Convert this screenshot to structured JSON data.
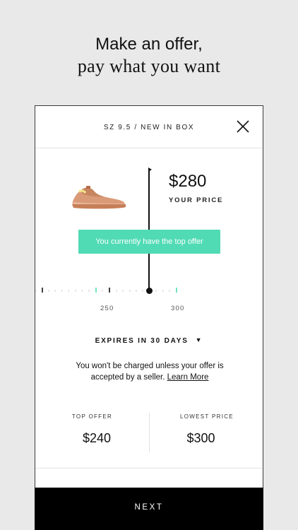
{
  "headline": {
    "line1": "Make an offer,",
    "line2": "pay what you want"
  },
  "card": {
    "size_label": "SZ 9.5 / NEW IN BOX",
    "close_icon": "close-icon",
    "price": "$280",
    "price_label": "YOUR PRICE",
    "toast": "You currently have the top offer",
    "slider": {
      "tick_labels": [
        "250",
        "300"
      ],
      "accent_color": "#51dbb5"
    },
    "expires_label": "EXPIRES IN 30 DAYS",
    "disclaimer": "You won't be charged unless your offer is accepted by a seller.",
    "learn_more": "Learn More",
    "stats": {
      "top_offer_label": "TOP OFFER",
      "top_offer_value": "$240",
      "lowest_price_label": "LOWEST PRICE",
      "lowest_price_value": "$300"
    }
  },
  "next_button": "NEXT"
}
